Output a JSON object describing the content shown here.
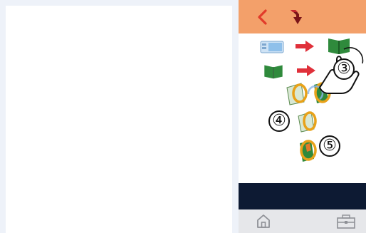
{
  "colors": {
    "topbar": "#f3a06a",
    "darkbar": "#0d1a33",
    "bottombar": "#e6e7ea",
    "arrow": "#e0303a",
    "book": "#2f8a3c",
    "ring": "#e8a21a",
    "background": "#eef2f9"
  },
  "icons": {
    "back": "chevron-left-icon",
    "redirect": "redirect-arrow-icon",
    "home": "home-icon",
    "box": "toolbox-icon"
  },
  "callouts": {
    "step3": "③",
    "step4": "④",
    "step5": "⑤"
  }
}
